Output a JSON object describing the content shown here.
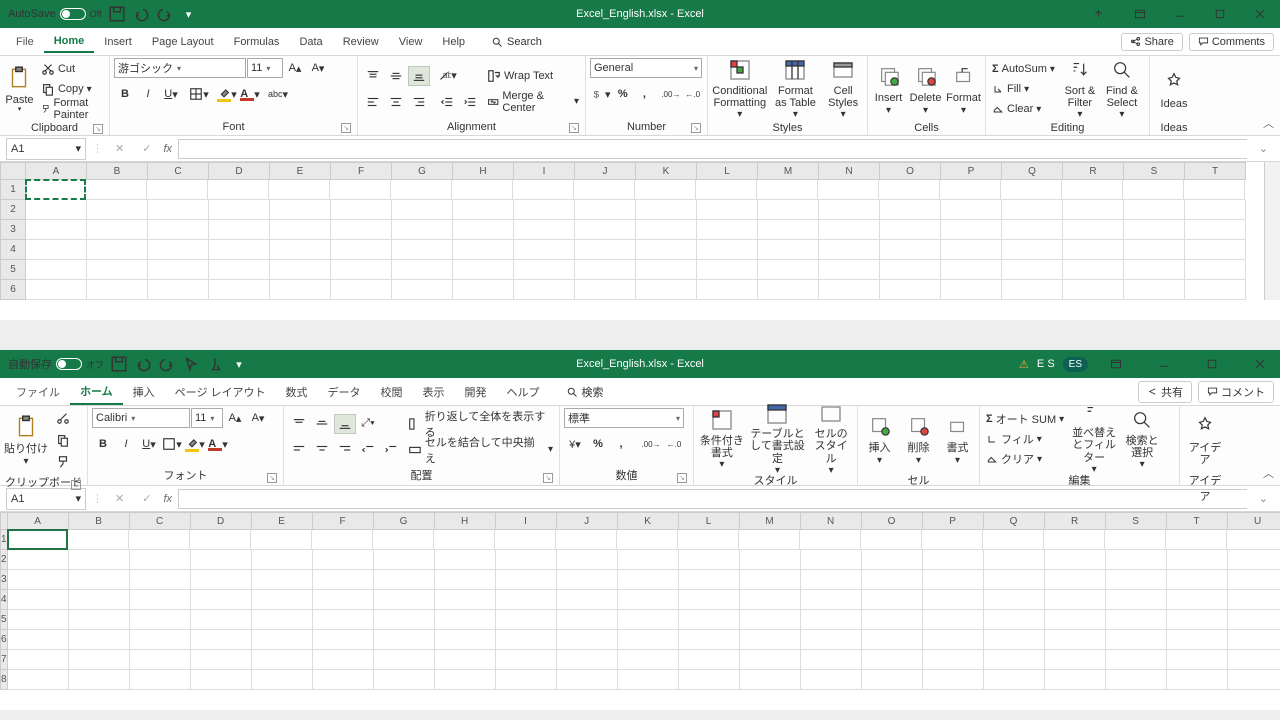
{
  "en": {
    "autosave_label": "AutoSave",
    "autosave_state": "Off",
    "title": "Excel_English.xlsx  -  Excel",
    "tabs": [
      "File",
      "Home",
      "Insert",
      "Page Layout",
      "Formulas",
      "Data",
      "Review",
      "View",
      "Help"
    ],
    "search": "Search",
    "share": "Share",
    "comments": "Comments",
    "clipboard": {
      "paste": "Paste",
      "cut": "Cut",
      "copy": "Copy",
      "painter": "Format Painter",
      "label": "Clipboard"
    },
    "font": {
      "name": "游ゴシック",
      "size": "11",
      "label": "Font"
    },
    "alignment": {
      "wrap": "Wrap Text",
      "merge": "Merge & Center",
      "label": "Alignment"
    },
    "number": {
      "format": "General",
      "label": "Number"
    },
    "styles": {
      "cf": "Conditional Formatting",
      "fat": "Format as Table",
      "cs": "Cell Styles",
      "label": "Styles"
    },
    "cells": {
      "insert": "Insert",
      "delete": "Delete",
      "format": "Format",
      "label": "Cells"
    },
    "editing": {
      "autosum": "AutoSum",
      "fill": "Fill",
      "clear": "Clear",
      "sort": "Sort & Filter",
      "find": "Find & Select",
      "label": "Editing"
    },
    "ideas": {
      "btn": "Ideas",
      "label": "Ideas"
    },
    "namebox": "A1",
    "cols": [
      "A",
      "B",
      "C",
      "D",
      "E",
      "F",
      "G",
      "H",
      "I",
      "J",
      "K",
      "L",
      "M",
      "N",
      "O",
      "P",
      "Q",
      "R",
      "S",
      "T"
    ],
    "rows": [
      "1",
      "2",
      "3",
      "4",
      "5",
      "6"
    ]
  },
  "jp": {
    "autosave_label": "自動保存",
    "autosave_state": "オフ",
    "title": "Excel_English.xlsx   -   Excel",
    "tabs": [
      "ファイル",
      "ホーム",
      "挿入",
      "ページ レイアウト",
      "数式",
      "データ",
      "校閲",
      "表示",
      "開発",
      "ヘルプ"
    ],
    "search": "検索",
    "share": "共有",
    "comments": "コメント",
    "clipboard": {
      "paste": "貼り付け",
      "label": "クリップボード"
    },
    "font": {
      "name": "Calibri",
      "size": "11",
      "label": "フォント"
    },
    "alignment": {
      "wrap": "折り返して全体を表示する",
      "merge": "セルを結合して中央揃え",
      "label": "配置"
    },
    "number": {
      "format": "標準",
      "label": "数値"
    },
    "styles": {
      "cf": "条件付き書式",
      "fat": "テーブルとして書式設定",
      "cs": "セルのスタイル",
      "label": "スタイル"
    },
    "cells": {
      "insert": "挿入",
      "delete": "削除",
      "format": "書式",
      "label": "セル"
    },
    "editing": {
      "autosum": "オート SUM",
      "fill": "フィル",
      "clear": "クリア",
      "sort": "並べ替えとフィルター",
      "find": "検索と選択",
      "label": "編集"
    },
    "ideas": {
      "btn": "アイデア",
      "label": "アイデア"
    },
    "lang": "E S",
    "badge": "ES",
    "namebox": "A1",
    "cols": [
      "A",
      "B",
      "C",
      "D",
      "E",
      "F",
      "G",
      "H",
      "I",
      "J",
      "K",
      "L",
      "M",
      "N",
      "O",
      "P",
      "Q",
      "R",
      "S",
      "T",
      "U"
    ],
    "rows": [
      "1",
      "2",
      "3",
      "4",
      "5",
      "6",
      "7",
      "8"
    ]
  }
}
